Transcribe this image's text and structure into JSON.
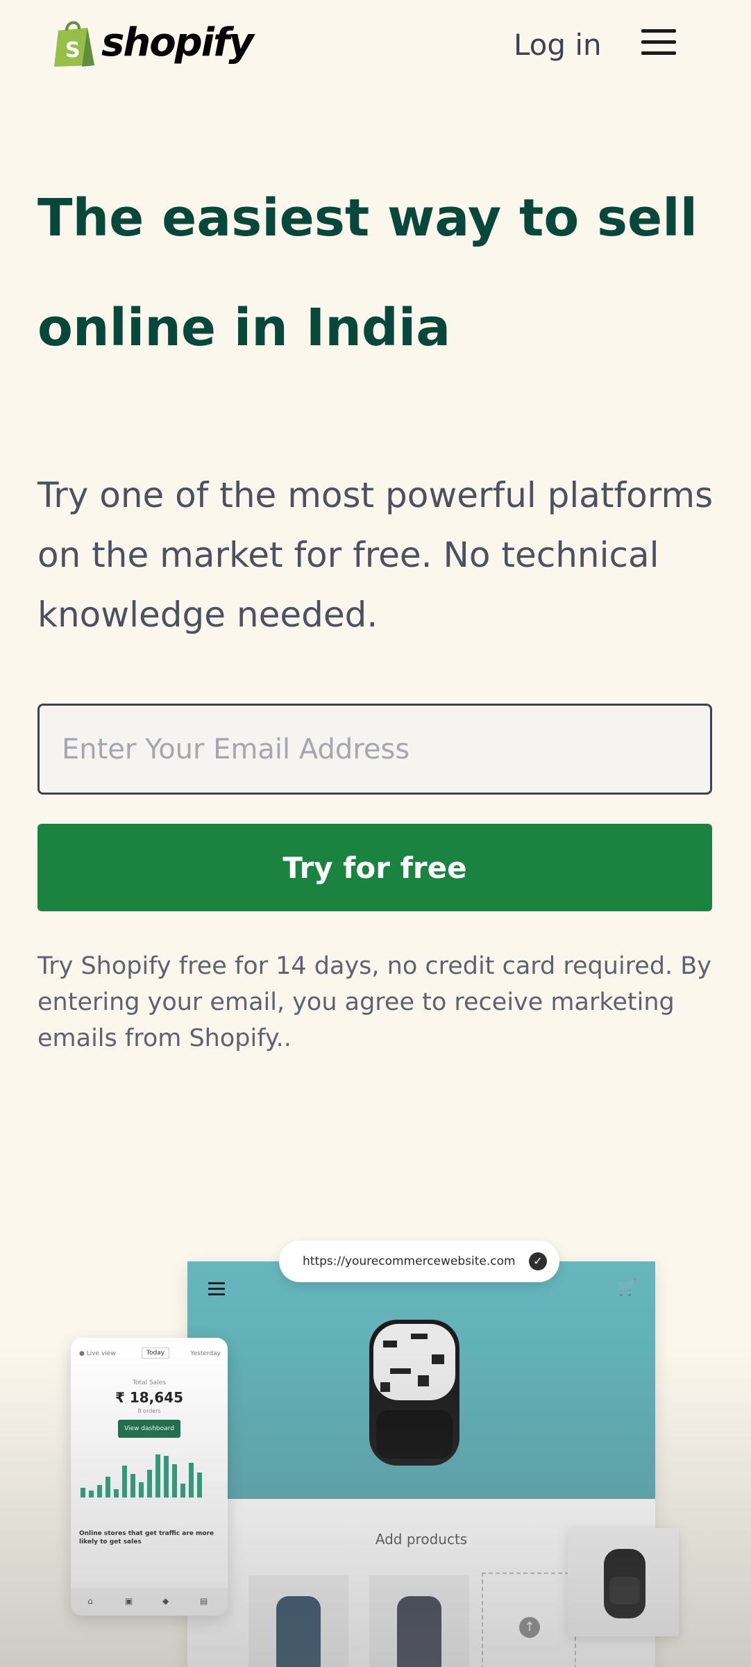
{
  "header": {
    "brand": "shopify",
    "login_label": "Log in",
    "menu_icon": "hamburger-menu-icon"
  },
  "hero": {
    "headline_line1": "The easiest way to sell",
    "headline_line2": "online in India",
    "subhead": "Try one of the most powerful platforms on the market for free. No technical knowledge needed.",
    "email_placeholder": "Enter Your Email Address",
    "email_value": "",
    "cta_label": "Try for free",
    "disclaimer": "Try Shopify free for 14 days, no credit card required. By entering your email, you agree to receive marketing emails from Shopify.."
  },
  "illustration": {
    "url_prefix": "https://",
    "url_domain": "yourecommercewebsite.com",
    "add_products": "Add products",
    "phone": {
      "live_view": "● Live view",
      "today": "Today",
      "yesterday": "Yesterday",
      "total_sales_label": "Total Sales",
      "total_sales_value": "₹ 18,645",
      "orders": "8 orders",
      "dashboard_button": "View dashboard",
      "message": "Online stores that get traffic are more likely to get sales"
    }
  },
  "colors": {
    "background": "#fbf7ed",
    "headline": "#08483b",
    "cta": "#1a833f",
    "brand_green": "#95bf47"
  }
}
